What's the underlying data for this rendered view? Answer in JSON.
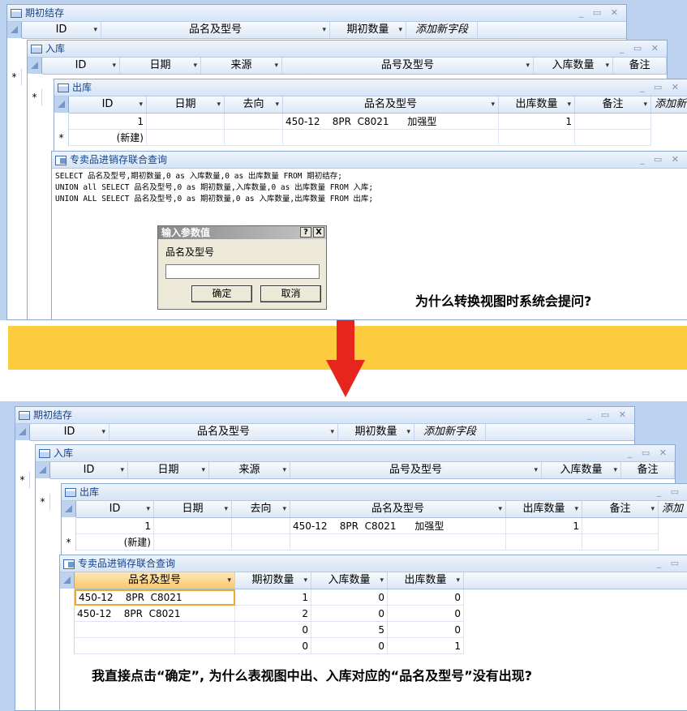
{
  "top": {
    "win1": {
      "title": "期初结存",
      "cols": [
        "ID",
        "品名及型号",
        "期初数量",
        "添加新字段"
      ],
      "new_mark": "*"
    },
    "win2": {
      "title": "入库",
      "cols": [
        "ID",
        "日期",
        "来源",
        "品号及型号",
        "入库数量",
        "备注"
      ],
      "new_mark": "*"
    },
    "win3": {
      "title": "出库",
      "cols": [
        "ID",
        "日期",
        "去向",
        "品名及型号",
        "出库数量",
        "备注",
        "添加新"
      ],
      "row": {
        "id": "1",
        "spec": "450-12    8PR  C8021      加强型",
        "qty": "1"
      },
      "new_row": {
        "mark": "*",
        "label": "(新建)"
      }
    },
    "win4": {
      "title": "专卖品进销存联合查询",
      "sql": [
        "SELECT 品名及型号,期初数量,0 as 入库数量,0 as 出库数量 FROM 期初结存;",
        "UNION all SELECT 品名及型号,0 as 期初数量,入库数量,0 as 出库数量 FROM 入库;",
        "UNION ALL SELECT 品名及型号,0 as 期初数量,0 as 入库数量,出库数量 FROM 出库;"
      ]
    },
    "dialog": {
      "title": "输入参数值",
      "help": "?",
      "close": "X",
      "label": "品名及型号",
      "value": "",
      "ok": "确定",
      "cancel": "取消"
    },
    "caption": "为什么转换视图时系统会提问?"
  },
  "bottom": {
    "win1": {
      "title": "期初结存",
      "cols": [
        "ID",
        "品名及型号",
        "期初数量",
        "添加新字段"
      ],
      "new_mark": "*"
    },
    "win2": {
      "title": "入库",
      "cols": [
        "ID",
        "日期",
        "来源",
        "品号及型号",
        "入库数量",
        "备注"
      ],
      "new_mark": "*"
    },
    "win3": {
      "title": "出库",
      "cols": [
        "ID",
        "日期",
        "去向",
        "品名及型号",
        "出库数量",
        "备注",
        "添加"
      ],
      "row": {
        "id": "1",
        "spec": "450-12    8PR  C8021      加强型",
        "qty": "1"
      },
      "new_row": {
        "mark": "*",
        "label": "(新建)"
      }
    },
    "win4": {
      "title": "专卖品进销存联合查询",
      "cols": [
        "品名及型号",
        "期初数量",
        "入库数量",
        "出库数量"
      ],
      "rows": [
        [
          "450-12    8PR  C8021",
          "1",
          "0",
          "0"
        ],
        [
          "450-12    8PR  C8021",
          "2",
          "0",
          "0"
        ],
        [
          "",
          "0",
          "5",
          "0"
        ],
        [
          "",
          "0",
          "0",
          "1"
        ]
      ]
    },
    "caption": "我直接点击“确定”, 为什么表视图中出、入库对应的“品名及型号”没有出现?"
  },
  "colors": {
    "accent_band": "#fccc3e",
    "arrow": "#e6261c",
    "window_bg": "#bcd2ee"
  }
}
